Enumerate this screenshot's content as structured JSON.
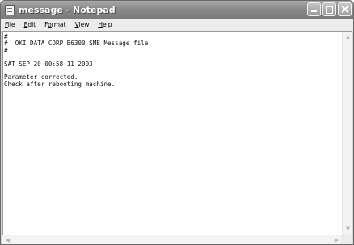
{
  "window": {
    "title": "message - Notepad",
    "icon": "notepad-icon"
  },
  "menu": [
    {
      "underline": "F",
      "rest": "ile"
    },
    {
      "underline": "E",
      "rest": "dit"
    },
    {
      "pre": "F",
      "underline": "o",
      "rest": "rmat"
    },
    {
      "underline": "V",
      "rest": "iew"
    },
    {
      "underline": "H",
      "rest": "elp"
    }
  ],
  "content": {
    "lines": [
      "#",
      "#  OKI DATA CORP B6300 SMB Message file",
      "#",
      "",
      "SAT SEP 20 00:58:11 2003",
      "",
      "Parameter corrected.",
      "Check after rebooting machine."
    ]
  },
  "scrollbar": {
    "up": "▲",
    "down": "▼",
    "left": "◀",
    "right": "▶"
  }
}
